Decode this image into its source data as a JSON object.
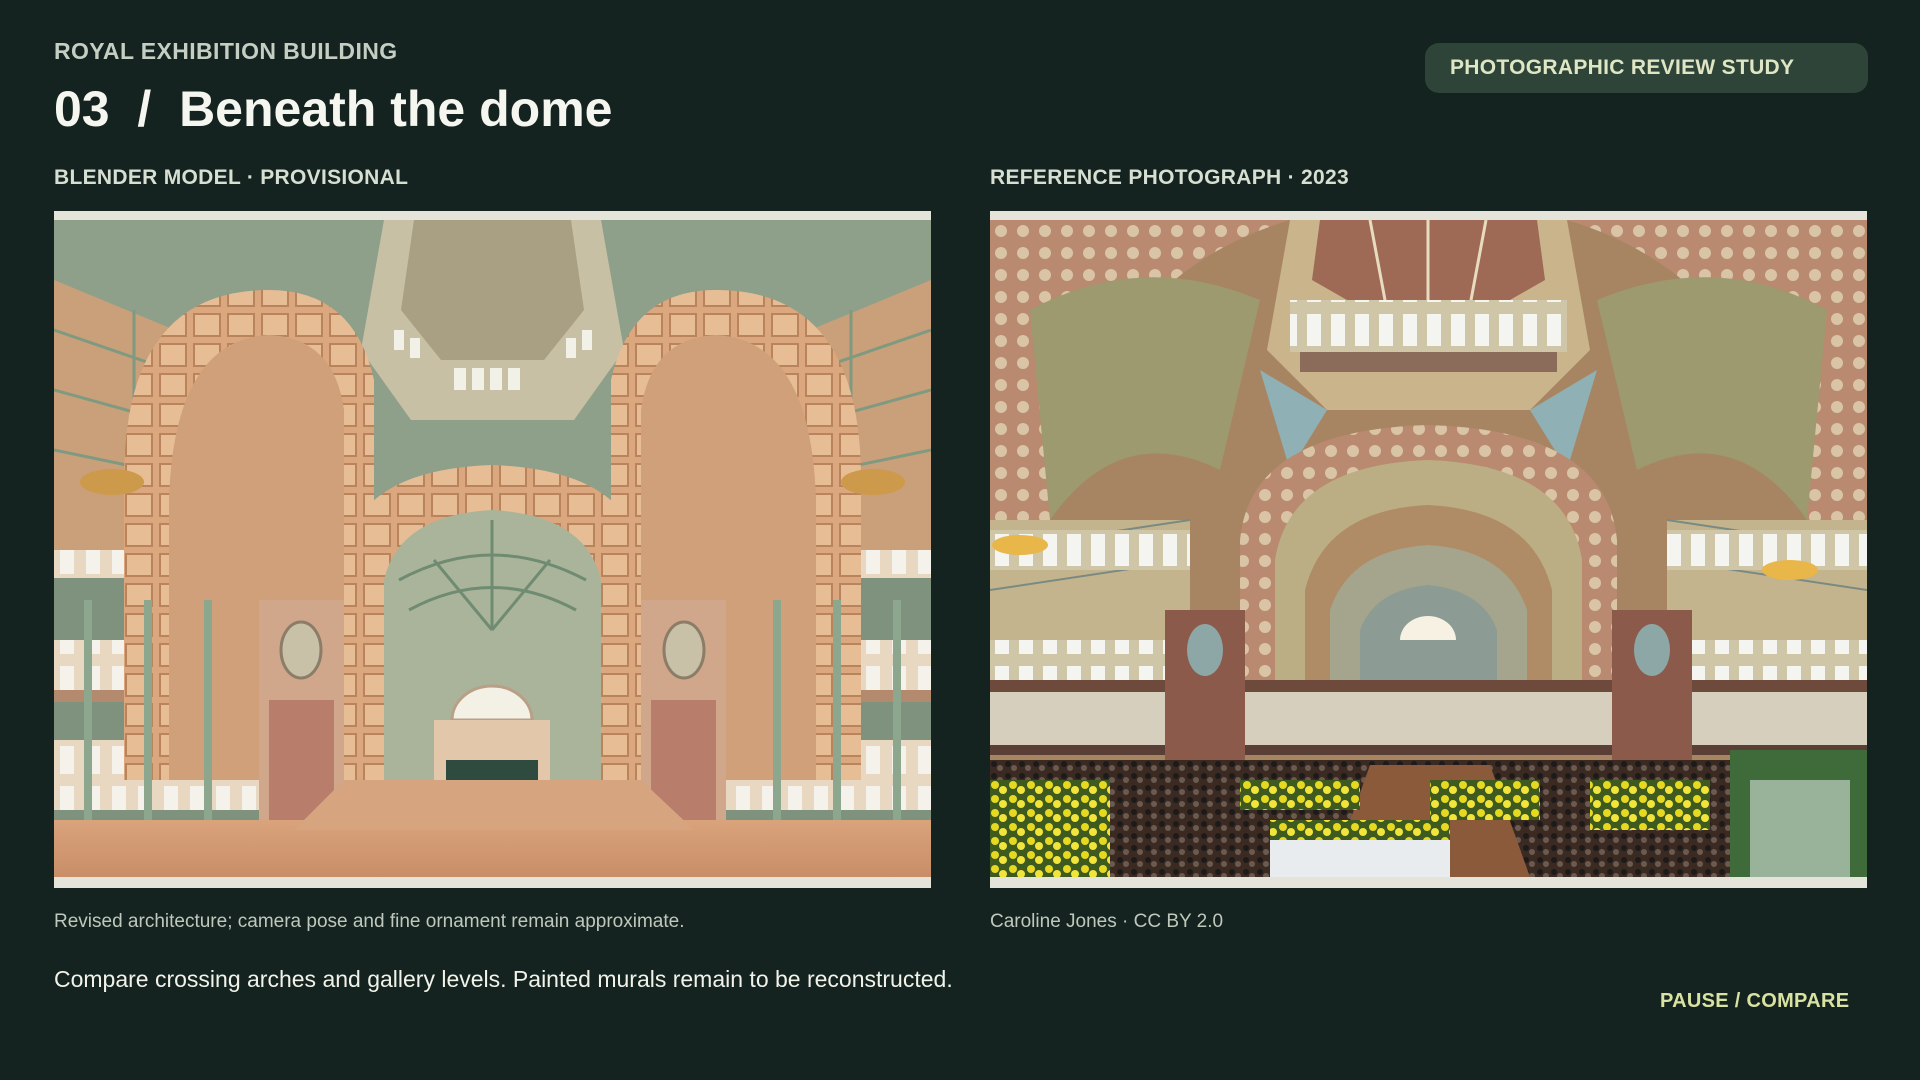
{
  "header": {
    "eyebrow": "ROYAL EXHIBITION BUILDING",
    "title": "03  /  Beneath the dome",
    "badge": "PHOTOGRAPHIC REVIEW STUDY"
  },
  "panels": {
    "model": {
      "label": "BLENDER MODEL · PROVISIONAL",
      "caption": "Revised architecture; camera pose and fine ornament remain approximate."
    },
    "photo": {
      "label": "REFERENCE PHOTOGRAPH · 2023",
      "caption": "Caroline Jones · CC BY 2.0"
    }
  },
  "footer": {
    "note": "Compare crossing arches and gallery levels. Painted murals remain to be reconstructed.",
    "control": "PAUSE / COMPARE"
  },
  "colors": {
    "background": "#14231f",
    "badge_bg": "#2f4438",
    "accent": "#d9e2a0"
  }
}
